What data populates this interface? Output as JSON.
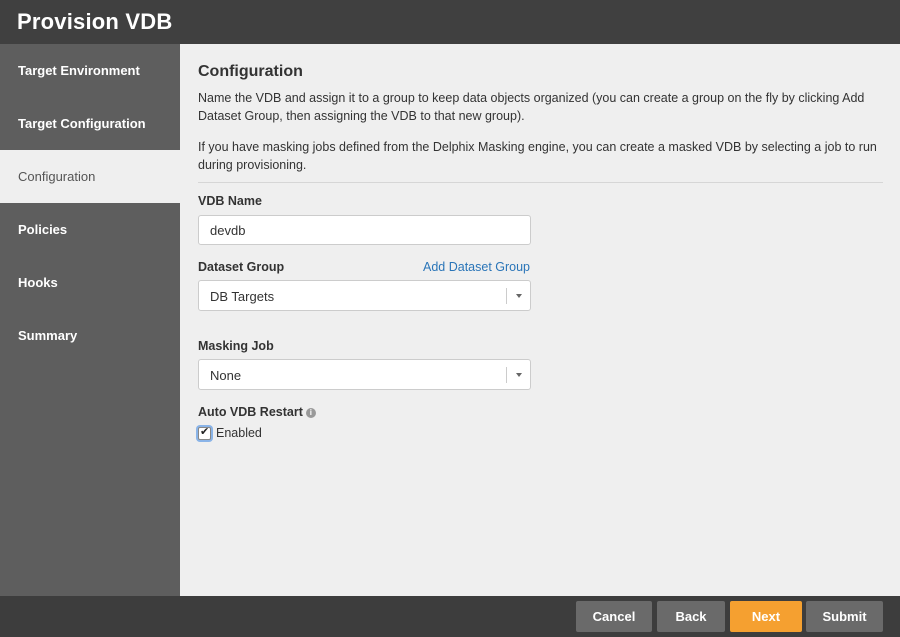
{
  "window": {
    "title": "Provision VDB"
  },
  "sidebar": {
    "items": [
      {
        "label": "Target Environment",
        "active": false
      },
      {
        "label": "Target Configuration",
        "active": false
      },
      {
        "label": "Configuration",
        "active": true
      },
      {
        "label": "Policies",
        "active": false
      },
      {
        "label": "Hooks",
        "active": false
      },
      {
        "label": "Summary",
        "active": false
      }
    ]
  },
  "main": {
    "heading": "Configuration",
    "description1": "Name the VDB and assign it to a group to keep data objects organized (you can create a group on the fly by clicking Add Dataset Group, then assigning the VDB to that new group).",
    "description2": "If you have masking jobs defined from the Delphix Masking engine, you can create a masked VDB by selecting a job to run during provisioning.",
    "vdb_name": {
      "label": "VDB Name",
      "value": "devdb"
    },
    "dataset_group": {
      "label": "Dataset Group",
      "value": "DB Targets",
      "add_link": "Add Dataset Group"
    },
    "masking_job": {
      "label": "Masking Job",
      "value": "None"
    },
    "auto_restart": {
      "label": "Auto VDB Restart",
      "info_icon": "info-icon",
      "checkbox_label": "Enabled",
      "checked": true
    }
  },
  "footer": {
    "cancel": "Cancel",
    "back": "Back",
    "next": "Next",
    "submit": "Submit"
  },
  "colors": {
    "accent": "#f5a030",
    "link": "#2a75b8",
    "sidebar": "#5e5e5e",
    "content_bg": "#efefef"
  }
}
